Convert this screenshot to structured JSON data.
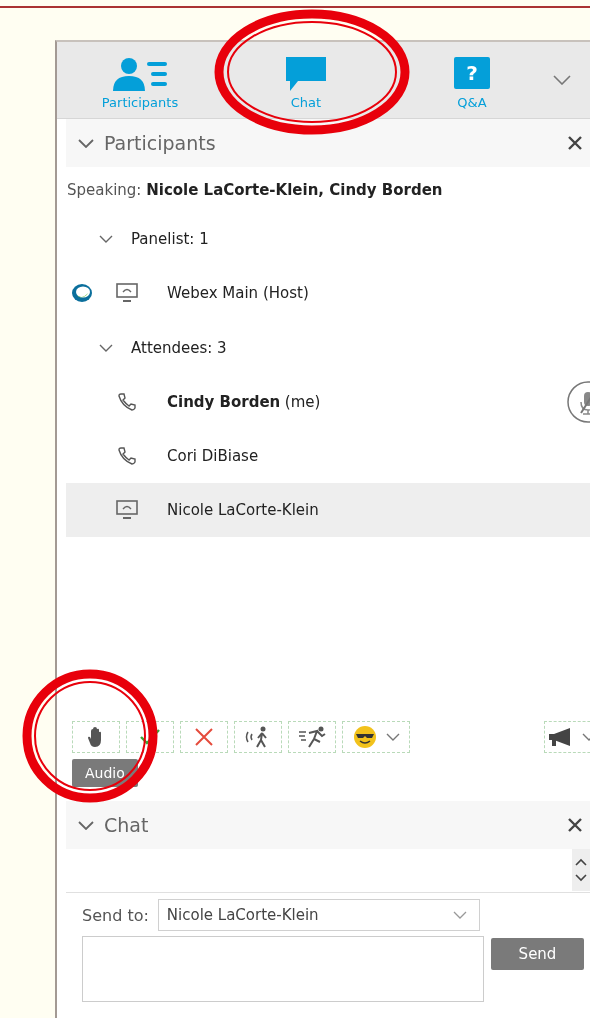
{
  "tabs": [
    {
      "label": "Participants",
      "kind": "participants"
    },
    {
      "label": "Chat",
      "kind": "chat"
    },
    {
      "label": "Q&A",
      "kind": "qa",
      "glyph": "?"
    }
  ],
  "participants": {
    "title": "Participants",
    "speaking_label": "Speaking:",
    "speaking": "Nicole LaCorte-Klein, Cindy Borden",
    "groups": [
      {
        "label": "Panelist: 1",
        "expanded": true,
        "children": [
          {
            "name": "Webex Main (Host)",
            "kind": "monitor",
            "presenter": true,
            "bold": false,
            "muted": false,
            "selected": false
          }
        ]
      },
      {
        "label": "Attendees: 3",
        "expanded": true,
        "children": [
          {
            "name": "Cindy Borden",
            "suffix": "(me)",
            "kind": "phone",
            "presenter": false,
            "bold": true,
            "muted": true,
            "selected": false
          },
          {
            "name": "Cori DiBiase",
            "kind": "phone",
            "presenter": false,
            "bold": false,
            "muted": false,
            "selected": false
          },
          {
            "name": "Nicole LaCorte-Klein",
            "kind": "monitor",
            "presenter": false,
            "bold": false,
            "muted": false,
            "selected": true
          }
        ]
      }
    ]
  },
  "toolbar": [
    {
      "kind": "hand"
    },
    {
      "kind": "check"
    },
    {
      "kind": "cross"
    },
    {
      "kind": "away"
    },
    {
      "kind": "run"
    },
    {
      "kind": "emoji"
    }
  ],
  "toolbar_right": [
    {
      "kind": "megaphone"
    }
  ],
  "tooltip": "Audio",
  "chat": {
    "title": "Chat",
    "send_to_label": "Send to:",
    "recipient": "Nicole LaCorte-Klein",
    "send_button": "Send"
  }
}
